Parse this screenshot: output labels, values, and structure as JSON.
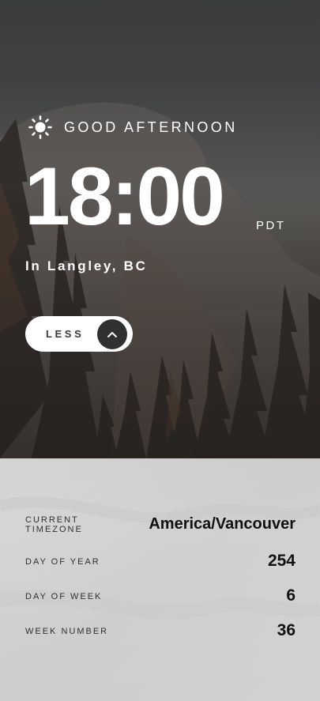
{
  "greeting": {
    "text": "GOOD AFTERNOON",
    "icon": "sun-icon"
  },
  "clock": {
    "time": "18:00",
    "timezone_abbr": "PDT",
    "location": "In Langley, BC"
  },
  "toggle": {
    "label": "LESS",
    "icon": "chevron-up-icon"
  },
  "details": {
    "rows": [
      {
        "label": [
          "CURRENT",
          "TIMEZONE"
        ],
        "value": "America/Vancouver"
      },
      {
        "label": [
          "DAY OF YEAR"
        ],
        "value": "254"
      },
      {
        "label": [
          "DAY OF WEEK"
        ],
        "value": "6"
      },
      {
        "label": [
          "WEEK NUMBER"
        ],
        "value": "36"
      }
    ]
  },
  "colors": {
    "panel_bg": "#d0d0d0",
    "button_bg": "#ffffff",
    "button_icon_bg": "#303030",
    "text_light": "#ffffff",
    "text_dark": "#111111"
  }
}
